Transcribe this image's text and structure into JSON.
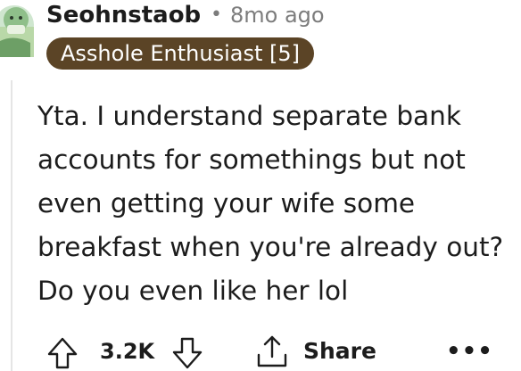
{
  "comment": {
    "author": "Seohnstaob",
    "separator": "•",
    "age": "8mo ago",
    "flair": "Asshole Enthusiast [5]",
    "body_lines": [
      "Yta. I understand separate bank",
      "accounts for somethings but not",
      "even getting your wife some",
      "breakfast when you're already out?",
      "Do you even like her lol"
    ],
    "votes": "3.2K",
    "share_label": "Share",
    "more_label": "•••"
  },
  "icons": {
    "upvote": "arrow-up-icon",
    "downvote": "arrow-down-icon",
    "share": "share-icon",
    "avatar": "avatar-image"
  },
  "colors": {
    "flair_bg": "#5b4426",
    "flair_text": "#ffffff",
    "meta_text": "#7c7c7c",
    "body_text": "#1c1c1c"
  }
}
